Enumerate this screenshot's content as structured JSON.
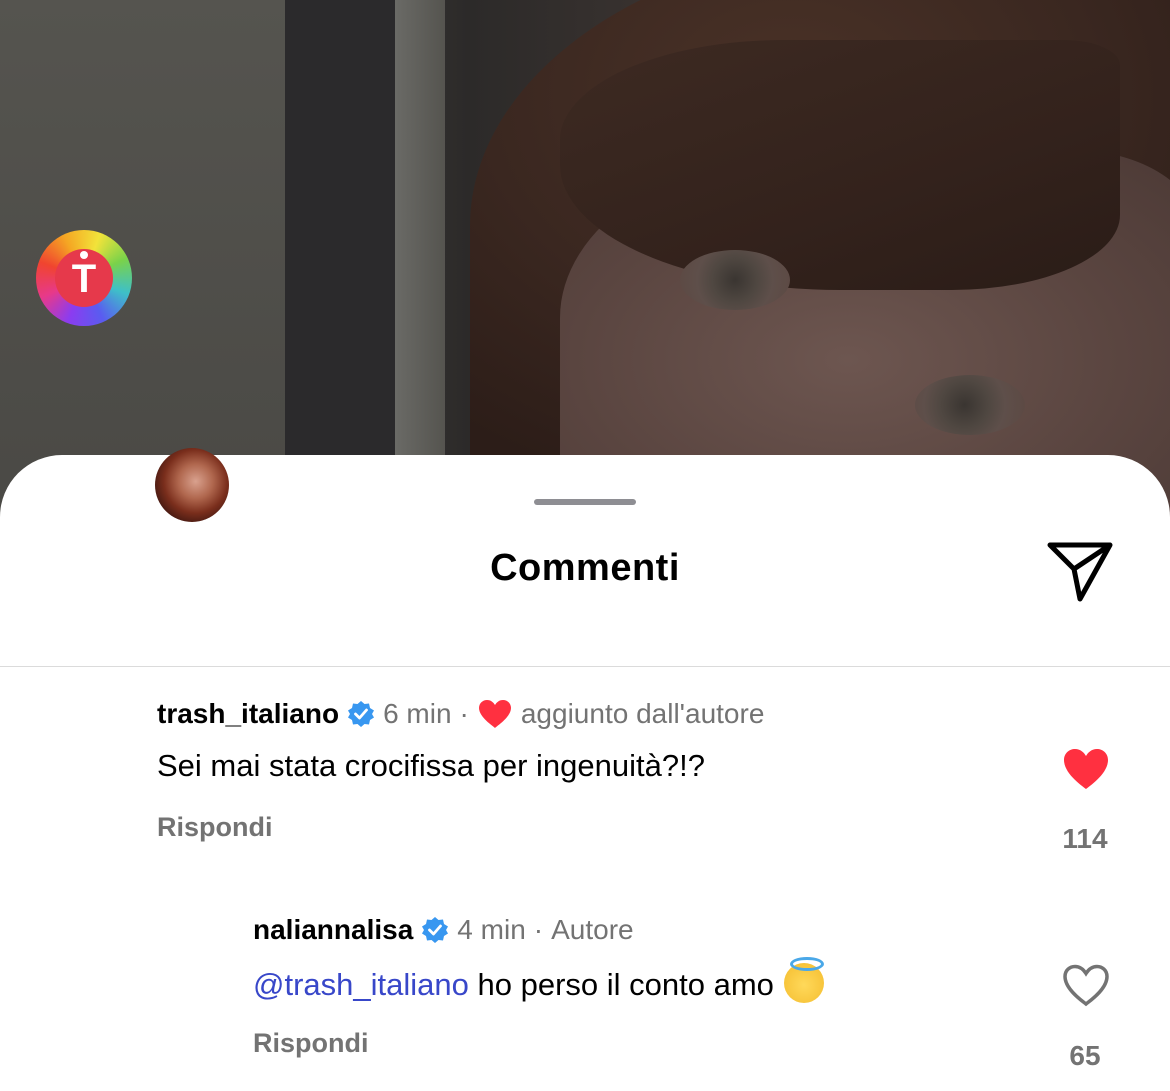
{
  "sheet": {
    "title": "Commenti"
  },
  "comments": [
    {
      "username": "trash_italiano",
      "verified": true,
      "time": "6 min",
      "separator": "·",
      "author_liked_label": "aggiunto dall'autore",
      "text": "Sei mai stata crocifissa per ingenuità?!?",
      "reply_label": "Rispondi",
      "liked": true,
      "like_count": "114",
      "avatar_letter": "T"
    },
    {
      "username": "naliannalisa",
      "verified": true,
      "time": "4 min",
      "separator": "·",
      "role_label": "Autore",
      "mention": "@trash_italiano",
      "text": " ho perso il conto amo",
      "emoji": "smiling-face-with-halo",
      "reply_label": "Rispondi",
      "liked": false,
      "like_count": "65"
    }
  ],
  "colors": {
    "like_red": "#ff3040",
    "verified_blue": "#3897f0",
    "mention_blue": "#3847c9",
    "secondary_text": "#737373"
  }
}
